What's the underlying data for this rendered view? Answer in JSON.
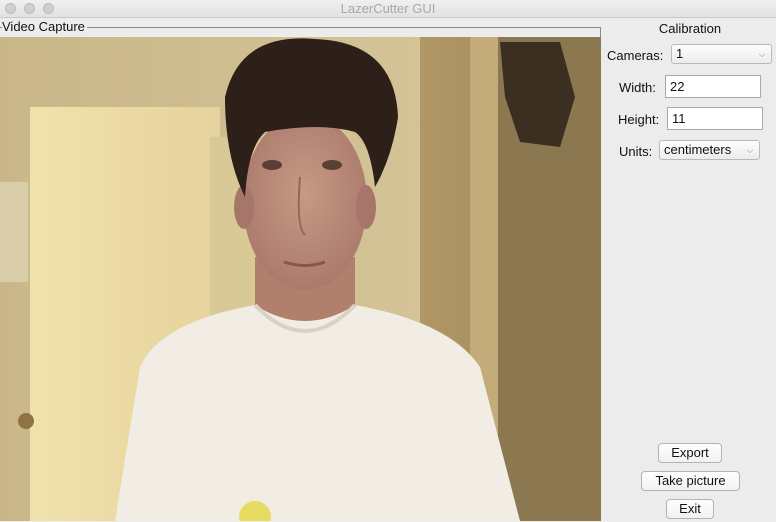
{
  "window": {
    "title": "LazerCutter GUI"
  },
  "video": {
    "label": "Video Capture"
  },
  "calibration": {
    "title": "Calibration",
    "cameras_label": "Cameras:",
    "cameras_value": "1",
    "width_label": "Width:",
    "width_value": "22",
    "height_label": "Height:",
    "height_value": "11",
    "units_label": "Units:",
    "units_value": "centimeters"
  },
  "buttons": {
    "export": "Export",
    "take_picture": "Take picture",
    "exit": "Exit"
  }
}
